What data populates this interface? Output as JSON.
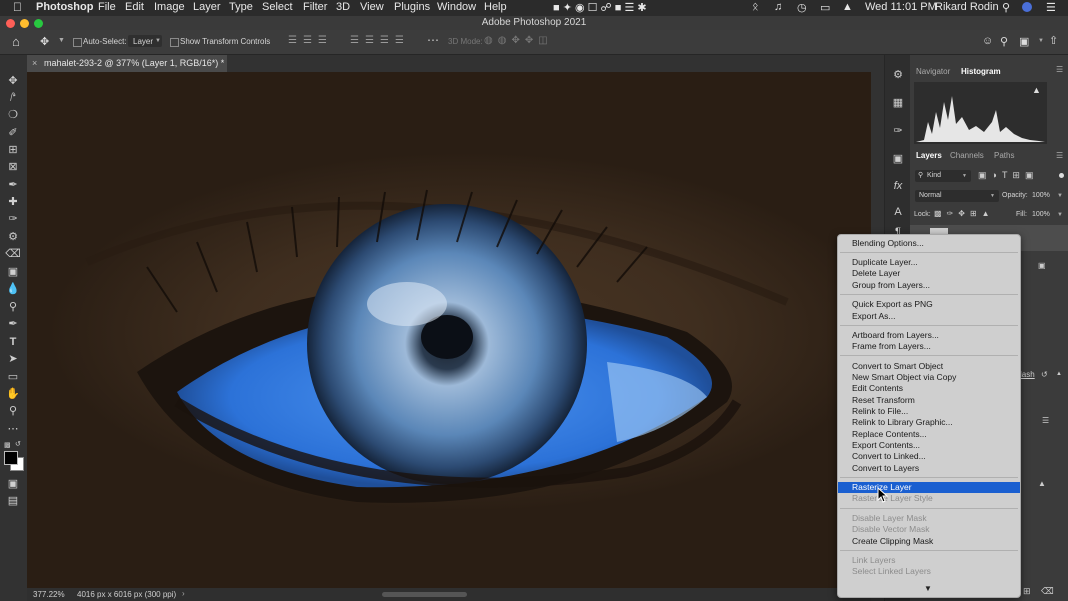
{
  "menubar": {
    "app": "Photoshop",
    "items": [
      "File",
      "Edit",
      "Image",
      "Layer",
      "Type",
      "Select",
      "Filter",
      "3D",
      "View",
      "Plugins",
      "Window",
      "Help"
    ],
    "clock": "Wed 11:01 PM",
    "user": "Rikard Rodin"
  },
  "window": {
    "title": "Adobe Photoshop 2021"
  },
  "options": {
    "auto_select_label": "Auto-Select:",
    "auto_select_value": "Layer",
    "show_transform_label": "Show Transform Controls",
    "mode_3d_label": "3D Mode:"
  },
  "document": {
    "tab_title": "mahalet-293-2 @ 377% (Layer 1, RGB/16*) *",
    "zoom": "377.22%",
    "doc_info": "4016 px x 6016 px (300 ppi)"
  },
  "panels": {
    "top_tabs": [
      "Navigator",
      "Histogram"
    ],
    "layer_tabs": [
      "Layers",
      "Channels",
      "Paths"
    ],
    "kind_label": "Kind",
    "blend_mode": "Normal",
    "opacity_label": "Opacity:",
    "opacity_value": "100%",
    "lock_label": "Lock:",
    "fill_label": "Fill:",
    "fill_value": "100%",
    "partial_text": "lash"
  },
  "context_menu": {
    "items": [
      {
        "label": "Blending Options...",
        "state": "normal"
      },
      {
        "sep": true
      },
      {
        "label": "Duplicate Layer...",
        "state": "normal"
      },
      {
        "label": "Delete Layer",
        "state": "normal"
      },
      {
        "label": "Group from Layers...",
        "state": "normal"
      },
      {
        "sep": true
      },
      {
        "label": "Quick Export as PNG",
        "state": "normal"
      },
      {
        "label": "Export As...",
        "state": "normal"
      },
      {
        "sep": true
      },
      {
        "label": "Artboard from Layers...",
        "state": "normal"
      },
      {
        "label": "Frame from Layers...",
        "state": "normal"
      },
      {
        "sep": true
      },
      {
        "label": "Convert to Smart Object",
        "state": "normal"
      },
      {
        "label": "New Smart Object via Copy",
        "state": "normal"
      },
      {
        "label": "Edit Contents",
        "state": "normal"
      },
      {
        "label": "Reset Transform",
        "state": "normal"
      },
      {
        "label": "Relink to File...",
        "state": "normal"
      },
      {
        "label": "Relink to Library Graphic...",
        "state": "normal"
      },
      {
        "label": "Replace Contents...",
        "state": "normal"
      },
      {
        "label": "Export Contents...",
        "state": "normal"
      },
      {
        "label": "Convert to Linked...",
        "state": "normal"
      },
      {
        "label": "Convert to Layers",
        "state": "normal"
      },
      {
        "sep": true
      },
      {
        "label": "Rasterize Layer",
        "state": "selected"
      },
      {
        "label": "Rasterize Layer Style",
        "state": "disabled"
      },
      {
        "sep": true
      },
      {
        "label": "Disable Layer Mask",
        "state": "disabled"
      },
      {
        "label": "Disable Vector Mask",
        "state": "disabled"
      },
      {
        "label": "Create Clipping Mask",
        "state": "normal"
      },
      {
        "sep": true
      },
      {
        "label": "Link Layers",
        "state": "disabled"
      },
      {
        "label": "Select Linked Layers",
        "state": "disabled"
      }
    ]
  },
  "colors": {
    "accent": "#1a5fd0",
    "iris": "#5b87b8",
    "sclera_tint": "#3d7fe0"
  }
}
